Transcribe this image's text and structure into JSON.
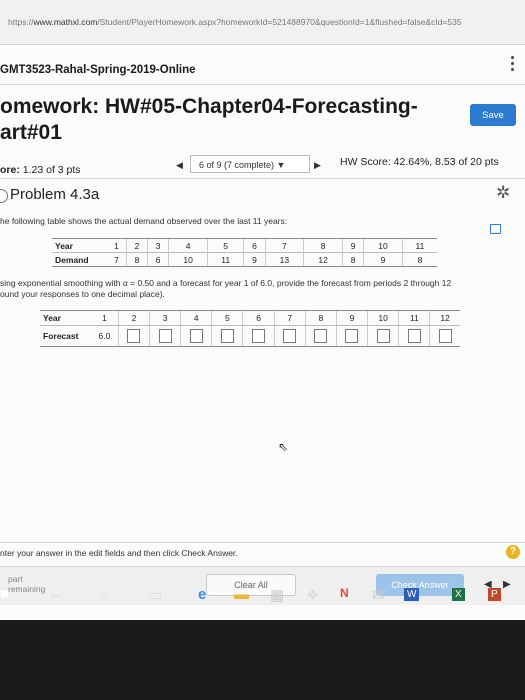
{
  "browser": {
    "url_prefix": "https://",
    "url_domain": "www.mathxl.com",
    "url_path": "/Student/PlayerHomework.aspx?homeworkId=521488970&questionId=1&flushed=false&cId=535"
  },
  "course": {
    "title": "GMT3523-Rahal-Spring-2019-Online"
  },
  "homework": {
    "title": "omework: HW#05-Chapter04-Forecasting-art#01",
    "save_label": "Save",
    "score_label": "ore:",
    "score_value": "1.23 of 3 pts",
    "page_selector": "6 of 9 (7 complete) ▼",
    "hw_score": "HW Score: 42.64%, 8.53 of 20 pts"
  },
  "problem": {
    "title": "Problem 4.3a",
    "intro": "he following table shows the actual demand observed over the last 11 years:",
    "instructions_line1": "sing exponential smoothing with α = 0.50 and a forecast for year 1 of 6.0, provide the forecast from periods 2 through 12",
    "instructions_line2": "ound your responses to one decimal place)."
  },
  "demand_table": {
    "row_year_label": "Year",
    "row_demand_label": "Demand",
    "years": [
      "1",
      "2",
      "3",
      "4",
      "5",
      "6",
      "7",
      "8",
      "9",
      "10",
      "11"
    ],
    "demand": [
      "7",
      "8",
      "6",
      "10",
      "11",
      "9",
      "13",
      "12",
      "8",
      "9",
      "8"
    ]
  },
  "forecast_table": {
    "row_year_label": "Year",
    "row_forecast_label": "Forecast",
    "years": [
      "1",
      "2",
      "3",
      "4",
      "5",
      "6",
      "7",
      "8",
      "9",
      "10",
      "11",
      "12"
    ],
    "forecast_1": "6.0"
  },
  "footer": {
    "instructions": "nter your answer in the edit fields and then click Check Answer.",
    "help_label": "?",
    "part_label": "part",
    "remaining_label": "remaining",
    "clear_all": "Clear All",
    "check_answer": "Check Answer"
  },
  "colors": {
    "accent": "#2b7bd1",
    "check_disabled": "#9cc3e8",
    "help": "#e7b51f"
  }
}
